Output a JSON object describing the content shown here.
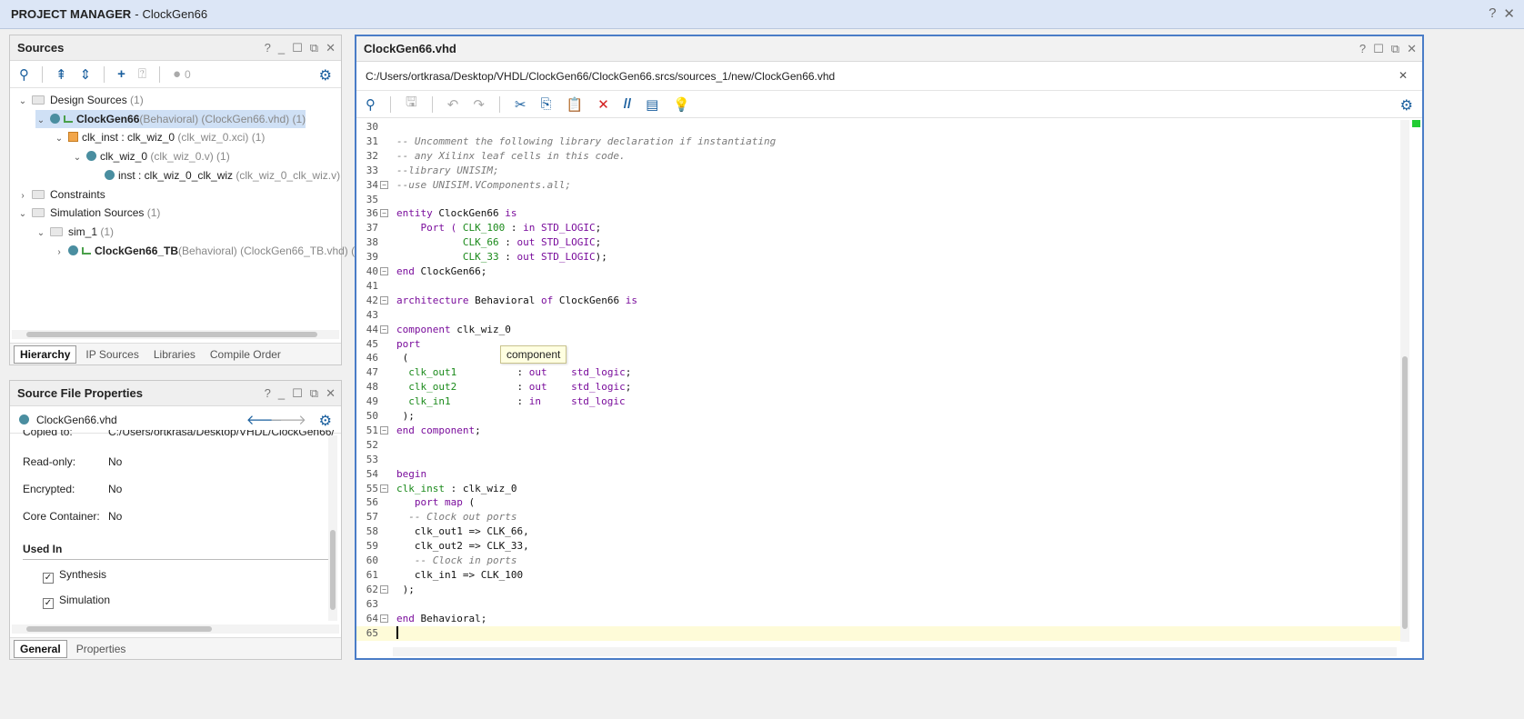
{
  "window": {
    "title_strong": "PROJECT MANAGER",
    "title_sep": " - ",
    "project_name": "ClockGen66",
    "help_icon": "?",
    "close_icon": "✕"
  },
  "sources_panel": {
    "title": "Sources",
    "status_count": "0",
    "tree": [
      {
        "indent": 0,
        "chevron": "v",
        "icon": "folder",
        "label": "Design Sources",
        "suffix": " (1)"
      },
      {
        "indent": 1,
        "chevron": "v",
        "icon": "module",
        "label": "ClockGen66",
        "suffix": "(Behavioral) (ClockGen66.vhd) (1)",
        "bold": true,
        "selected": true
      },
      {
        "indent": 2,
        "chevron": "v",
        "icon": "xci",
        "label": "clk_inst : clk_wiz_0",
        "suffix": " (clk_wiz_0.xci) (1)"
      },
      {
        "indent": 3,
        "chevron": "v",
        "icon": "dot",
        "label": "clk_wiz_0",
        "suffix": " (clk_wiz_0.v) (1)"
      },
      {
        "indent": 4,
        "chevron": "",
        "icon": "dot",
        "label": "inst : clk_wiz_0_clk_wiz",
        "suffix": " (clk_wiz_0_clk_wiz.v)"
      },
      {
        "indent": 0,
        "chevron": ">",
        "icon": "folder",
        "label": "Constraints",
        "suffix": ""
      },
      {
        "indent": 0,
        "chevron": "v",
        "icon": "folder",
        "label": "Simulation Sources",
        "suffix": " (1)"
      },
      {
        "indent": 1,
        "chevron": "v",
        "icon": "folder",
        "label": "sim_1",
        "suffix": " (1)"
      },
      {
        "indent": 2,
        "chevron": ">",
        "icon": "module",
        "label": "ClockGen66_TB",
        "suffix": "(Behavioral) (ClockGen66_TB.vhd) (",
        "bold": true
      }
    ],
    "tabs": [
      "Hierarchy",
      "IP Sources",
      "Libraries",
      "Compile Order"
    ],
    "active_tab": "Hierarchy"
  },
  "properties_panel": {
    "title": "Source File Properties",
    "file_name": "ClockGen66.vhd",
    "rows": [
      {
        "key": "Copied to:",
        "value": "C:/Users/ortkrasa/Desktop/VHDL/ClockGen66/"
      },
      {
        "key": "Read-only:",
        "value": "No"
      },
      {
        "key": "Encrypted:",
        "value": "No"
      },
      {
        "key": "Core Container:",
        "value": "No"
      }
    ],
    "used_in_heading": "Used In",
    "used_in": [
      {
        "label": "Synthesis",
        "checked": true
      },
      {
        "label": "Simulation",
        "checked": true
      }
    ],
    "tabs": [
      "General",
      "Properties"
    ],
    "active_tab": "General"
  },
  "editor": {
    "tab_title": "ClockGen66.vhd",
    "file_path": "C:/Users/ortkrasa/Desktop/VHDL/ClockGen66/ClockGen66.srcs/sources_1/new/ClockGen66.vhd",
    "tooltip": "component",
    "current_line": 65,
    "lines": [
      {
        "n": 30,
        "fold": "",
        "tokens": []
      },
      {
        "n": 31,
        "fold": "",
        "tokens": [
          {
            "t": "-- Uncomment the following library declaration if instantiating",
            "c": "com"
          }
        ]
      },
      {
        "n": 32,
        "fold": "",
        "tokens": [
          {
            "t": "-- any Xilinx leaf cells in this code.",
            "c": "com"
          }
        ]
      },
      {
        "n": 33,
        "fold": "",
        "tokens": [
          {
            "t": "--library UNISIM;",
            "c": "com"
          }
        ]
      },
      {
        "n": 34,
        "fold": "-",
        "tokens": [
          {
            "t": "--use UNISIM.VComponents.all;",
            "c": "com"
          }
        ]
      },
      {
        "n": 35,
        "fold": "",
        "tokens": []
      },
      {
        "n": 36,
        "fold": "-",
        "tokens": [
          {
            "t": "entity",
            "c": "kw"
          },
          {
            "t": " ClockGen66 ",
            "c": "plain"
          },
          {
            "t": "is",
            "c": "kw"
          }
        ]
      },
      {
        "n": 37,
        "fold": "",
        "tokens": [
          {
            "t": "    Port ( ",
            "c": "kw"
          },
          {
            "t": "CLK_100",
            "c": "id"
          },
          {
            "t": " : ",
            "c": "plain"
          },
          {
            "t": "in",
            "c": "kw"
          },
          {
            "t": " STD_LOGIC",
            "c": "kw"
          },
          {
            "t": ";",
            "c": "plain"
          }
        ]
      },
      {
        "n": 38,
        "fold": "",
        "tokens": [
          {
            "t": "           CLK_66",
            "c": "id"
          },
          {
            "t": " : ",
            "c": "plain"
          },
          {
            "t": "out",
            "c": "kw"
          },
          {
            "t": " STD_LOGIC",
            "c": "kw"
          },
          {
            "t": ";",
            "c": "plain"
          }
        ]
      },
      {
        "n": 39,
        "fold": "",
        "tokens": [
          {
            "t": "           CLK_33",
            "c": "id"
          },
          {
            "t": " : ",
            "c": "plain"
          },
          {
            "t": "out",
            "c": "kw"
          },
          {
            "t": " STD_LOGIC",
            "c": "kw"
          },
          {
            "t": ");",
            "c": "plain"
          }
        ]
      },
      {
        "n": 40,
        "fold": "-",
        "tokens": [
          {
            "t": "end",
            "c": "kw"
          },
          {
            "t": " ClockGen66;",
            "c": "plain"
          }
        ]
      },
      {
        "n": 41,
        "fold": "",
        "tokens": []
      },
      {
        "n": 42,
        "fold": "-",
        "tokens": [
          {
            "t": "architecture",
            "c": "kw"
          },
          {
            "t": " Behavioral ",
            "c": "plain"
          },
          {
            "t": "of",
            "c": "kw"
          },
          {
            "t": " ClockGen66 ",
            "c": "plain"
          },
          {
            "t": "is",
            "c": "kw"
          }
        ]
      },
      {
        "n": 43,
        "fold": "",
        "tokens": []
      },
      {
        "n": 44,
        "fold": "-",
        "tokens": [
          {
            "t": "component",
            "c": "kw"
          },
          {
            "t": " clk_wiz_0",
            "c": "plain"
          }
        ]
      },
      {
        "n": 45,
        "fold": "",
        "tokens": [
          {
            "t": "port",
            "c": "kw"
          }
        ]
      },
      {
        "n": 46,
        "fold": "",
        "tokens": [
          {
            "t": " (",
            "c": "plain"
          }
        ]
      },
      {
        "n": 47,
        "fold": "",
        "tokens": [
          {
            "t": "  clk_out1",
            "c": "id"
          },
          {
            "t": "          : ",
            "c": "plain"
          },
          {
            "t": "out",
            "c": "kw"
          },
          {
            "t": "    std_logic",
            "c": "kw"
          },
          {
            "t": ";",
            "c": "plain"
          }
        ]
      },
      {
        "n": 48,
        "fold": "",
        "tokens": [
          {
            "t": "  clk_out2",
            "c": "id"
          },
          {
            "t": "          : ",
            "c": "plain"
          },
          {
            "t": "out",
            "c": "kw"
          },
          {
            "t": "    std_logic",
            "c": "kw"
          },
          {
            "t": ";",
            "c": "plain"
          }
        ]
      },
      {
        "n": 49,
        "fold": "",
        "tokens": [
          {
            "t": "  clk_in1",
            "c": "id"
          },
          {
            "t": "           : ",
            "c": "plain"
          },
          {
            "t": "in",
            "c": "kw"
          },
          {
            "t": "     std_logic",
            "c": "kw"
          }
        ]
      },
      {
        "n": 50,
        "fold": "",
        "tokens": [
          {
            "t": " );",
            "c": "plain"
          }
        ]
      },
      {
        "n": 51,
        "fold": "-",
        "tokens": [
          {
            "t": "end component",
            "c": "kw"
          },
          {
            "t": ";",
            "c": "plain"
          }
        ]
      },
      {
        "n": 52,
        "fold": "",
        "tokens": []
      },
      {
        "n": 53,
        "fold": "",
        "tokens": []
      },
      {
        "n": 54,
        "fold": "",
        "tokens": [
          {
            "t": "begin",
            "c": "kw"
          }
        ]
      },
      {
        "n": 55,
        "fold": "-",
        "tokens": [
          {
            "t": "clk_inst",
            "c": "id"
          },
          {
            "t": " : clk_wiz_0",
            "c": "plain"
          }
        ]
      },
      {
        "n": 56,
        "fold": "",
        "tokens": [
          {
            "t": "   port map",
            "c": "kw"
          },
          {
            "t": " (",
            "c": "plain"
          }
        ]
      },
      {
        "n": 57,
        "fold": "",
        "tokens": [
          {
            "t": "  -- Clock out ports",
            "c": "com"
          }
        ]
      },
      {
        "n": 58,
        "fold": "",
        "tokens": [
          {
            "t": "   clk_out1 => CLK_66,",
            "c": "plain"
          }
        ]
      },
      {
        "n": 59,
        "fold": "",
        "tokens": [
          {
            "t": "   clk_out2 => CLK_33,",
            "c": "plain"
          }
        ]
      },
      {
        "n": 60,
        "fold": "",
        "tokens": [
          {
            "t": "   -- Clock in ports",
            "c": "com"
          }
        ]
      },
      {
        "n": 61,
        "fold": "",
        "tokens": [
          {
            "t": "   clk_in1 => CLK_100",
            "c": "plain"
          }
        ]
      },
      {
        "n": 62,
        "fold": "-",
        "tokens": [
          {
            "t": " );",
            "c": "plain"
          }
        ]
      },
      {
        "n": 63,
        "fold": "",
        "tokens": []
      },
      {
        "n": 64,
        "fold": "-",
        "tokens": [
          {
            "t": "end",
            "c": "kw"
          },
          {
            "t": " Behavioral;",
            "c": "plain"
          }
        ]
      },
      {
        "n": 65,
        "fold": "",
        "tokens": []
      }
    ]
  }
}
